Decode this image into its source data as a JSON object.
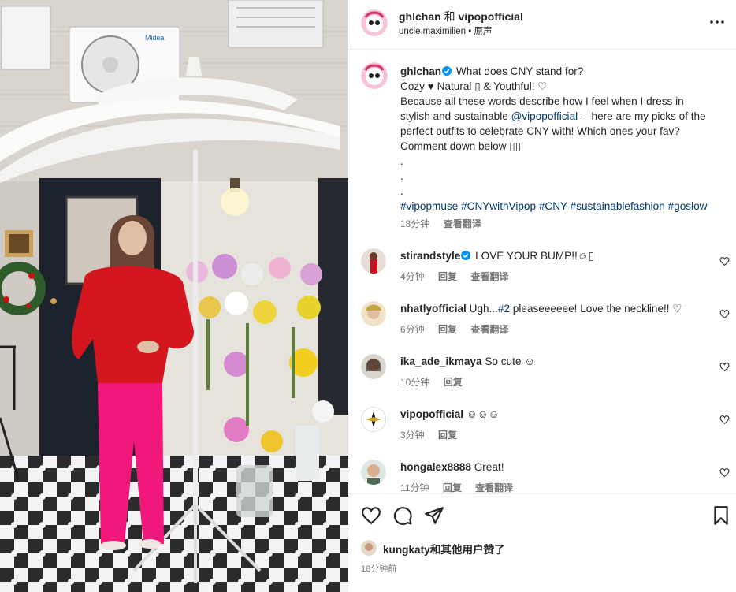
{
  "colors": {
    "accent_link": "#00376b",
    "verified_blue": "#0095f6",
    "secondary_text": "#737373",
    "sweater_red": "#d4161f",
    "pants_pink": "#f0187a"
  },
  "header": {
    "account": "ghlchan",
    "joiner": "和",
    "coauthor": "vipopofficial",
    "audio": "uncle.maximilien",
    "dot": "•",
    "original": "原声",
    "menu_icon": "more-horizontal-icon"
  },
  "media": {
    "wall_sign": "Midea"
  },
  "caption": {
    "username": "ghlchan",
    "line1": "What does CNY stand for?",
    "line2a": "Cozy",
    "line2_heart": "♥",
    "line2b": "Natural",
    "line2_box": "▯",
    "line2c": "& Youthful!",
    "line2_heart2": "♡",
    "line3": "Because all these words describe how I feel when I dress in",
    "line4a": "stylish and sustainable",
    "mention": "@vipopofficial",
    "line4b": "—here are my picks of the",
    "line5": "perfect outfits to celebrate CNY with! Which ones your fav?",
    "line6": "Comment down below ▯▯",
    "dot1": ".",
    "dot2": ".",
    "dot3": ".",
    "hashtags": [
      "#vipopmuse",
      "#CNYwithVipop",
      "#CNY",
      "#sustainablefashion",
      "#goslow"
    ],
    "time": "18分钟",
    "translate": "查看翻译"
  },
  "comments": [
    {
      "username": "stirandstyle",
      "verified": true,
      "text": "LOVE YOUR BUMP!!☺▯",
      "time": "4分钟",
      "reply": "回复",
      "translate": "查看翻译"
    },
    {
      "username": "nhatlyofficial",
      "verified": false,
      "text_before": "Ugh...",
      "tag": "#2",
      "text_after": " pleaseeeeee! Love the neckline!! ♡",
      "time": "6分钟",
      "reply": "回复",
      "translate": "查看翻译"
    },
    {
      "username": "ika_ade_ikmaya",
      "verified": false,
      "text": "So cute ☺",
      "time": "10分钟",
      "reply": "回复"
    },
    {
      "username": "vipopofficial",
      "verified": false,
      "text": "☺☺☺",
      "time": "3分钟",
      "reply": "回复"
    },
    {
      "username": "hongalex8888",
      "verified": false,
      "text": "Great!",
      "time": "11分钟",
      "reply": "回复",
      "translate": "查看翻译"
    }
  ],
  "actions": {
    "like_icon": "heart-icon",
    "comment_icon": "comment-icon",
    "share_icon": "send-icon",
    "save_icon": "bookmark-icon",
    "liked_by_user": "kungkaty",
    "liked_by_rest": "和其他用户赞了",
    "posted": "18分钟前"
  }
}
